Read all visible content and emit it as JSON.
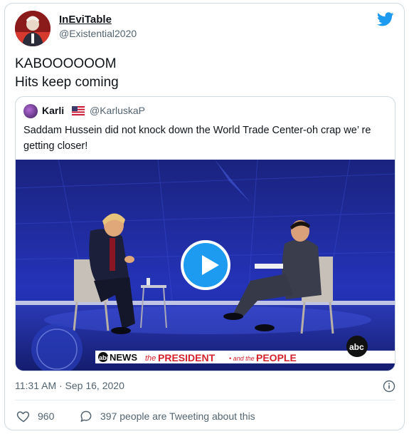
{
  "author": {
    "display_name": "InEviTable",
    "handle": "@Existential2020"
  },
  "tweet": {
    "lines": [
      "KABOOOOOOM",
      "Hits keep coming"
    ],
    "timestamp": "11:31 AM · Sep 16, 2020",
    "likes": "960",
    "replies_text": "397 people are Tweeting about this"
  },
  "quoted_tweet": {
    "display_name": "Karli",
    "handle": "@KarluskaP",
    "text": "Saddam Hussein did not knock down the World Trade Center-oh crap we’ re getting closer!"
  },
  "video": {
    "banner_network": "NEWS",
    "banner_the": "the",
    "banner_president": "PRESIDENT",
    "banner_and": "• and the •",
    "banner_people": "PEOPLE",
    "logo": "abc"
  },
  "colors": {
    "accent": "#1d9bf0",
    "text_secondary": "#536471",
    "border": "#cfd9de",
    "stage_blue": "#1f2a9e",
    "banner_red": "#d4212b"
  },
  "icons": [
    "twitter-bird-icon",
    "us-flag-icon",
    "play-icon",
    "info-icon",
    "heart-icon",
    "reply-bubble-icon"
  ]
}
